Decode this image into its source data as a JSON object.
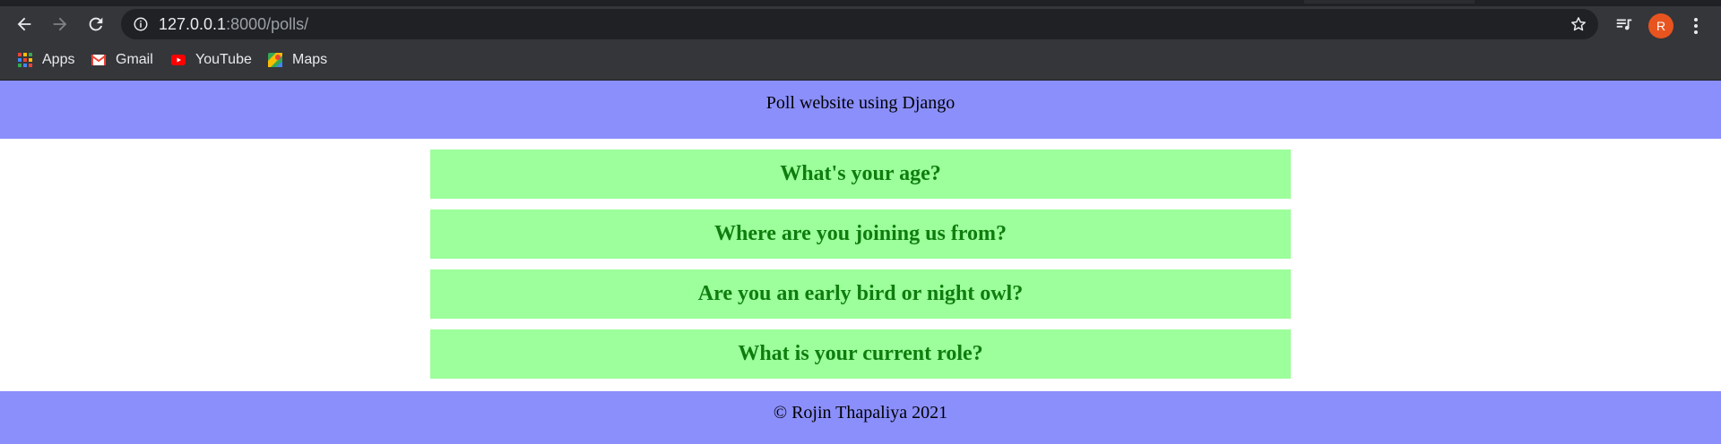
{
  "browser": {
    "address_bar": {
      "host": "127.0.0.1",
      "path": ":8000/polls/"
    },
    "profile": {
      "avatar_letter": "R",
      "avatar_color": "#e8541f"
    },
    "bookmarks": [
      {
        "label": "Apps",
        "icon": "apps-grid-icon"
      },
      {
        "label": "Gmail",
        "icon": "gmail-icon"
      },
      {
        "label": "YouTube",
        "icon": "youtube-icon"
      },
      {
        "label": "Maps",
        "icon": "maps-icon"
      }
    ]
  },
  "page": {
    "header_text": "Poll website using Django",
    "questions": [
      {
        "text": "What's your age?"
      },
      {
        "text": "Where are you joining us from?"
      },
      {
        "text": "Are you an early bird or night owl?"
      },
      {
        "text": "What is your current role?"
      }
    ],
    "footer_text": "© Rojin Thapaliya 2021",
    "colors": {
      "header_footer_bg": "#8b8ffc",
      "question_bg": "#9cff9b",
      "question_text": "#0e7d0e"
    }
  }
}
